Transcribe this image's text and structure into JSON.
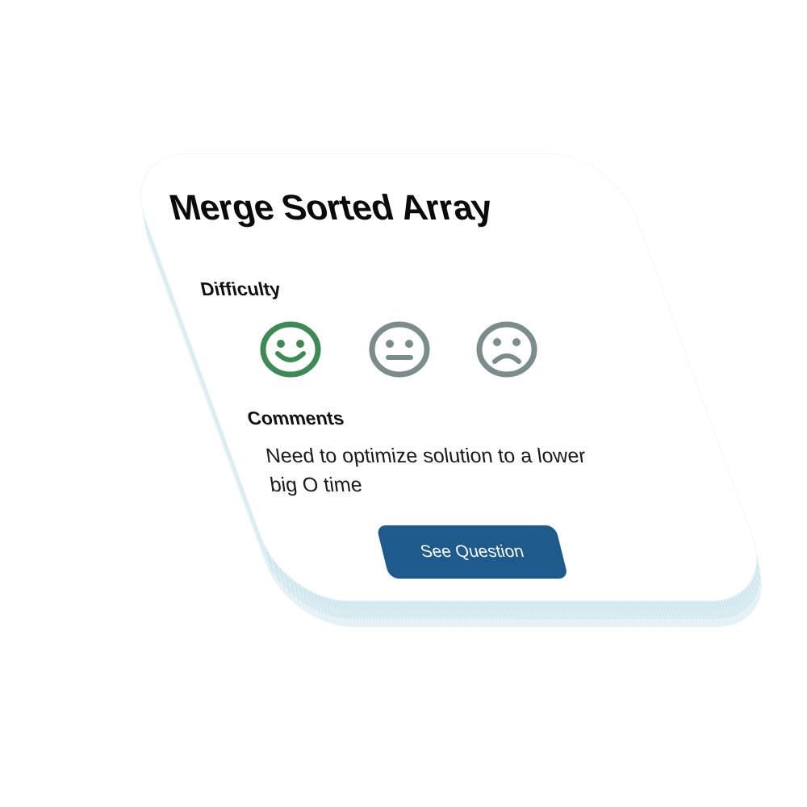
{
  "card": {
    "title": "Merge Sorted Array",
    "difficulty": {
      "label": "Difficulty",
      "options": [
        {
          "icon": "smile-face-icon",
          "selected": true,
          "color": "#3d8a55"
        },
        {
          "icon": "neutral-face-icon",
          "selected": false,
          "color": "#7a8c8c"
        },
        {
          "icon": "frown-face-icon",
          "selected": false,
          "color": "#7a8c8c"
        }
      ]
    },
    "comments": {
      "label": "Comments",
      "text": "Need to optimize solution to a lower big O time"
    },
    "button": {
      "label": "See Question",
      "color": "#1e5a8c"
    }
  }
}
